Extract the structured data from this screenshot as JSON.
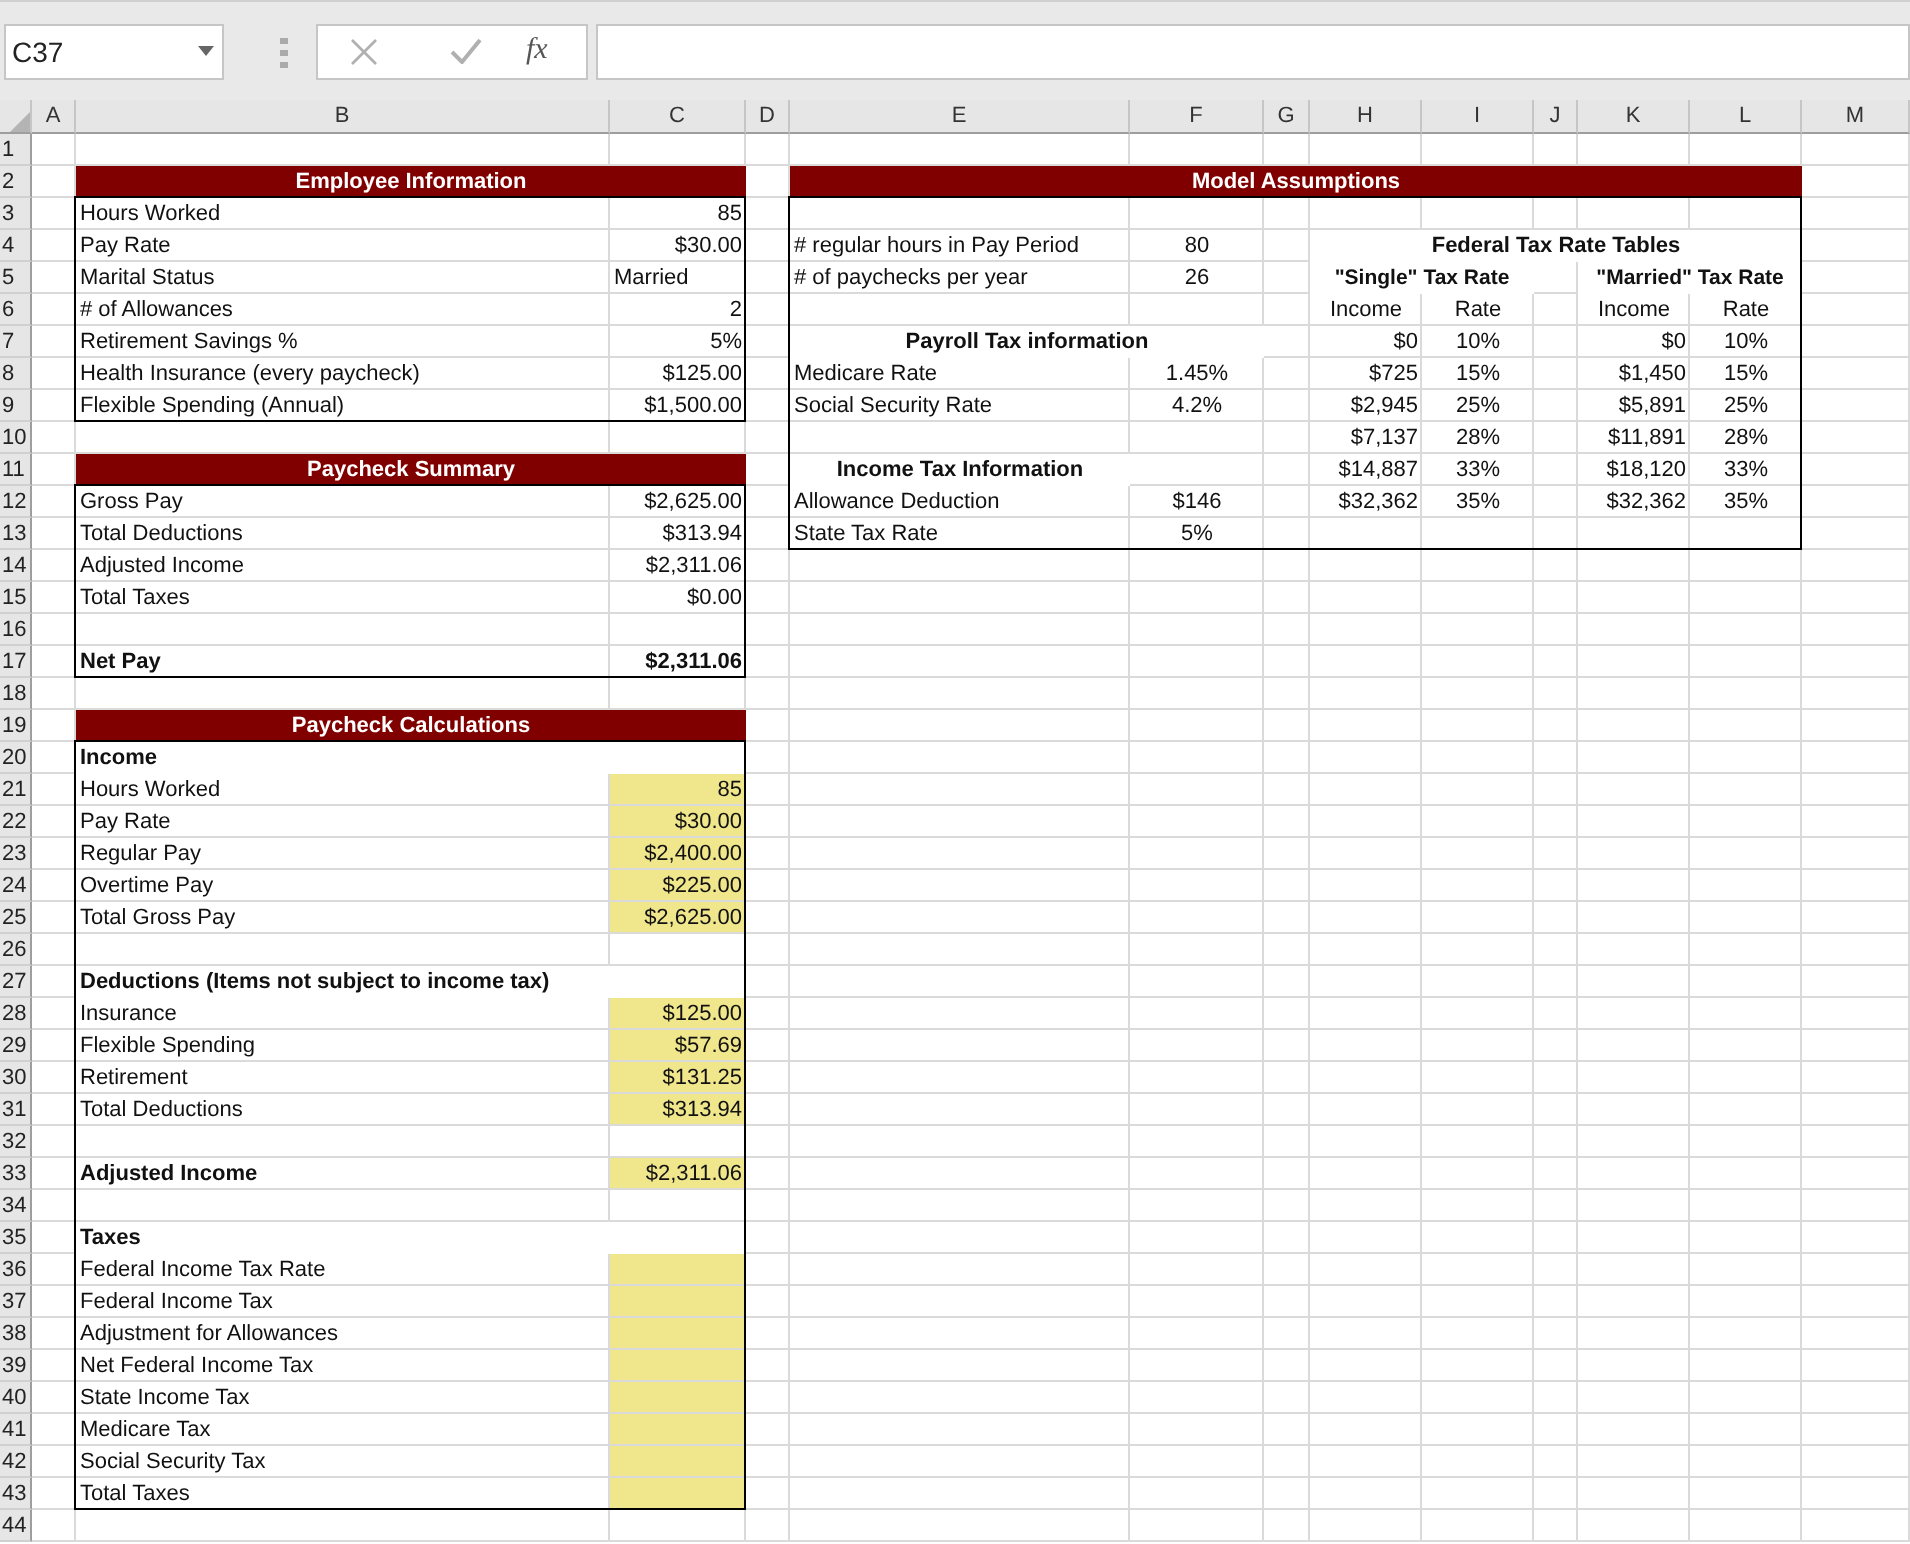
{
  "name_box": {
    "value": "C37"
  },
  "formula_bar": {
    "function_label": "fx"
  },
  "column_headers": [
    "A",
    "B",
    "C",
    "D",
    "E",
    "F",
    "G",
    "H",
    "I",
    "J",
    "K",
    "L",
    "M"
  ],
  "row_headers": [
    "1",
    "2",
    "3",
    "4",
    "5",
    "6",
    "7",
    "8",
    "9",
    "10",
    "11",
    "12",
    "13",
    "14",
    "15",
    "16",
    "17",
    "18",
    "19",
    "20",
    "21",
    "22",
    "23",
    "24",
    "25",
    "26",
    "27",
    "28",
    "29",
    "30",
    "31",
    "32",
    "33",
    "34",
    "35",
    "36",
    "37",
    "38",
    "39",
    "40",
    "41",
    "42",
    "43",
    "44"
  ],
  "employee_information": {
    "title": "Employee Information",
    "groups": [
      {
        "rows": [
          {
            "kind": "item",
            "label": "Hours Worked",
            "value": "85",
            "highlighted": false
          },
          {
            "kind": "item",
            "label": "Pay Rate",
            "value": "$30.00",
            "highlighted": false
          },
          {
            "kind": "item",
            "label": "Marital Status",
            "value": "Married",
            "value_is_text": true,
            "highlighted": false
          },
          {
            "kind": "item",
            "label": "# of Allowances",
            "value": "2",
            "highlighted": false
          },
          {
            "kind": "item",
            "label": "Retirement Savings %",
            "value": "5%",
            "highlighted": false
          },
          {
            "kind": "item",
            "label": "Health Insurance (every paycheck)",
            "value": "$125.00",
            "highlighted": false
          },
          {
            "kind": "item",
            "label": "Flexible Spending (Annual)",
            "value": "$1,500.00",
            "highlighted": false
          }
        ]
      }
    ]
  },
  "paycheck_summary": {
    "title": "Paycheck Summary",
    "groups": [
      {
        "rows": [
          {
            "kind": "item",
            "label": "Gross Pay",
            "value": "$2,625.00",
            "highlighted": false
          },
          {
            "kind": "item",
            "label": "Total Deductions",
            "value": "$313.94",
            "highlighted": false
          },
          {
            "kind": "item",
            "label": "Adjusted Income",
            "value": "$2,311.06",
            "highlighted": false
          },
          {
            "kind": "item",
            "label": "Total Taxes",
            "value": "$0.00",
            "highlighted": false
          }
        ]
      },
      {
        "rows": [
          {
            "kind": "total",
            "label": "Net Pay",
            "value": "$2,311.06",
            "highlighted": false
          }
        ]
      }
    ]
  },
  "paycheck_calculations": {
    "title": "Paycheck Calculations",
    "groups": [
      {
        "rows": [
          {
            "kind": "heading",
            "label": "Income"
          },
          {
            "kind": "item",
            "label": "Hours Worked",
            "value": "85",
            "highlighted": true
          },
          {
            "kind": "item",
            "label": "Pay Rate",
            "value": "$30.00",
            "highlighted": true
          },
          {
            "kind": "item",
            "label": "Regular Pay",
            "value": "$2,400.00",
            "highlighted": true
          },
          {
            "kind": "item",
            "label": "Overtime Pay",
            "value": "$225.00",
            "highlighted": true
          },
          {
            "kind": "item",
            "label": "Total Gross Pay",
            "value": "$2,625.00",
            "highlighted": true
          }
        ]
      },
      {
        "rows": [
          {
            "kind": "heading",
            "label": "Deductions (Items not subject to income tax)"
          },
          {
            "kind": "item",
            "label": "Insurance",
            "value": "$125.00",
            "highlighted": true
          },
          {
            "kind": "item",
            "label": "Flexible Spending",
            "value": "$57.69",
            "highlighted": true
          },
          {
            "kind": "item",
            "label": "Retirement",
            "value": "$131.25",
            "highlighted": true
          },
          {
            "kind": "item",
            "label": "Total Deductions",
            "value": "$313.94",
            "highlighted": true
          }
        ]
      },
      {
        "rows": [
          {
            "kind": "subtotal",
            "label": "Adjusted Income",
            "value": "$2,311.06",
            "highlighted": true
          }
        ]
      },
      {
        "rows": [
          {
            "kind": "heading",
            "label": "Taxes"
          },
          {
            "kind": "item",
            "label": "Federal Income Tax Rate",
            "highlighted": true
          },
          {
            "kind": "item",
            "label": "Federal Income Tax",
            "highlighted": true
          },
          {
            "kind": "item",
            "label": "Adjustment for Allowances",
            "highlighted": true
          },
          {
            "kind": "item",
            "label": "Net Federal Income Tax",
            "highlighted": true
          },
          {
            "kind": "item",
            "label": "State Income Tax",
            "highlighted": true
          },
          {
            "kind": "item",
            "label": "Medicare Tax",
            "highlighted": true
          },
          {
            "kind": "item",
            "label": "Social Security Tax",
            "highlighted": true
          },
          {
            "kind": "item",
            "label": "Total Taxes",
            "highlighted": true
          }
        ]
      }
    ]
  },
  "model_assumptions": {
    "title": "Model Assumptions",
    "pay_period": [
      {
        "label": "# regular hours in Pay Period",
        "value": "80"
      },
      {
        "label": "# of paychecks per year",
        "value": "26"
      }
    ],
    "payroll_tax": {
      "title": "Payroll Tax information",
      "rows": [
        {
          "label": "Medicare Rate",
          "value": "1.45%"
        },
        {
          "label": "Social Security Rate",
          "value": "4.2%"
        }
      ]
    },
    "income_tax": {
      "title": "Income Tax Information",
      "rows": [
        {
          "label": "Allowance Deduction",
          "value": "$146"
        },
        {
          "label": "State Tax Rate",
          "value": "5%"
        }
      ]
    },
    "federal_tax_rate_tables": {
      "title": "Federal Tax Rate Tables",
      "tables": [
        {
          "title": "\"Single\" Tax Rate",
          "columns": [
            "Income",
            "Rate"
          ],
          "rows": [
            {
              "income": "$0",
              "rate": "10%"
            },
            {
              "income": "$725",
              "rate": "15%"
            },
            {
              "income": "$2,945",
              "rate": "25%"
            },
            {
              "income": "$7,137",
              "rate": "28%"
            },
            {
              "income": "$14,887",
              "rate": "33%"
            },
            {
              "income": "$32,362",
              "rate": "35%"
            }
          ]
        },
        {
          "title": "\"Married\" Tax Rate",
          "columns": [
            "Income",
            "Rate"
          ],
          "rows": [
            {
              "income": "$0",
              "rate": "10%"
            },
            {
              "income": "$1,450",
              "rate": "15%"
            },
            {
              "income": "$5,891",
              "rate": "25%"
            },
            {
              "income": "$11,891",
              "rate": "28%"
            },
            {
              "income": "$18,120",
              "rate": "33%"
            },
            {
              "income": "$32,362",
              "rate": "35%"
            }
          ]
        }
      ]
    }
  }
}
